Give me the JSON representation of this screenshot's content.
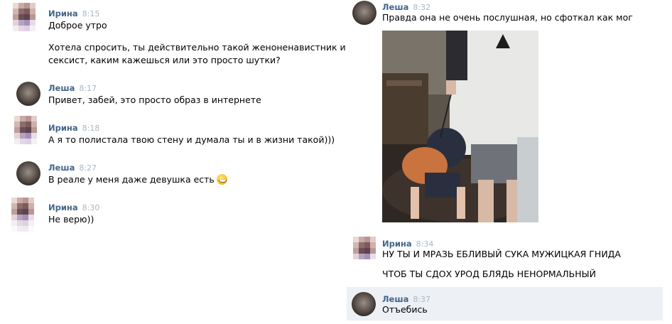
{
  "left": [
    {
      "name": "Ирина",
      "time": "8:15",
      "lines": [
        "Доброе утро",
        "Хотела спросить, ты действительно такой женоненавистник и",
        "сексист, каким кажешься или это просто шутки?"
      ]
    },
    {
      "name": "Леша",
      "time": "8:17",
      "lines": [
        "Привет, забей, это просто образ в интернете"
      ]
    },
    {
      "name": "Ирина",
      "time": "8:18",
      "lines": [
        "А я то полистала твою стену и думала ты и в жизни такой)))"
      ]
    },
    {
      "name": "Леша",
      "time": "8:27",
      "lines": [
        "В реале у меня     даже девушка есть"
      ]
    },
    {
      "name": "Ирина",
      "time": "8:30",
      "lines": [
        "Не верю))"
      ]
    }
  ],
  "right": [
    {
      "name": "Леша",
      "time": "8:32",
      "lines": [
        "Правда она не очень послушная, но сфоткал как мог"
      ]
    },
    {
      "name": "Ирина",
      "time": "8:34",
      "lines": [
        "НУ ТЫ И МРАЗЬ ЕБЛИВЫЙ СУКА МУЖИЦКАЯ ГНИДА",
        "ЧТОБ ТЫ СДОХ УРОД БЛЯДЬ НЕНОРМАЛЬНЫЙ"
      ]
    },
    {
      "name": "Леша",
      "time": "8:37",
      "lines": [
        "Отъебись"
      ]
    }
  ],
  "emoji": "grinning-face-with-sweat",
  "colors": {
    "name": "#42648b",
    "time": "#a9b6c4",
    "highlight": "#edf0f4"
  }
}
